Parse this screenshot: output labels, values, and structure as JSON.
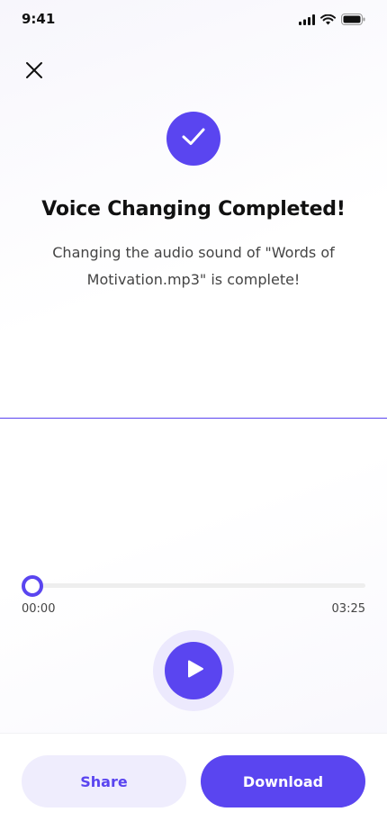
{
  "status_bar": {
    "time": "9:41",
    "icons": [
      "cellular-signal-icon",
      "wifi-icon",
      "battery-icon"
    ]
  },
  "header": {
    "close_icon": "close-icon"
  },
  "result": {
    "icon": "check-icon",
    "title": "Voice Changing Completed!",
    "message": "Changing the audio sound of \"Words of Motivation.mp3\" is complete!"
  },
  "player": {
    "current_time": "00:00",
    "total_time": "03:25",
    "progress": 0,
    "play_icon": "play-icon"
  },
  "actions": {
    "share_label": "Share",
    "download_label": "Download"
  },
  "colors": {
    "accent": "#5a45f0",
    "accent_light": "#efedfd",
    "text": "#111111"
  }
}
